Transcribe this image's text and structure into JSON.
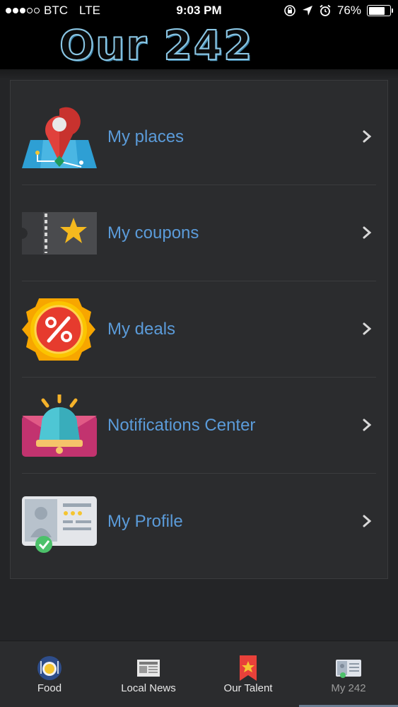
{
  "status_bar": {
    "carrier": "BTC",
    "network": "LTE",
    "time": "9:03 PM",
    "battery_percent": "76%",
    "battery_level": 0.76
  },
  "header": {
    "logo_text": "Our 242"
  },
  "menu": {
    "items": [
      {
        "label": "My places",
        "icon": "map-pin-icon"
      },
      {
        "label": "My coupons",
        "icon": "coupon-ticket-icon"
      },
      {
        "label": "My deals",
        "icon": "percent-badge-icon"
      },
      {
        "label": "Notifications Center",
        "icon": "bell-icon"
      },
      {
        "label": "My Profile",
        "icon": "profile-card-icon"
      }
    ],
    "label_color": "#5b9bd9"
  },
  "tabbar": {
    "tabs": [
      {
        "label": "Food",
        "icon": "food-plate-icon",
        "active": false
      },
      {
        "label": "Local News",
        "icon": "newspaper-icon",
        "active": false
      },
      {
        "label": "Our Talent",
        "icon": "star-ribbon-icon",
        "active": false
      },
      {
        "label": "My 242",
        "icon": "profile-card-icon",
        "active": true
      }
    ]
  }
}
